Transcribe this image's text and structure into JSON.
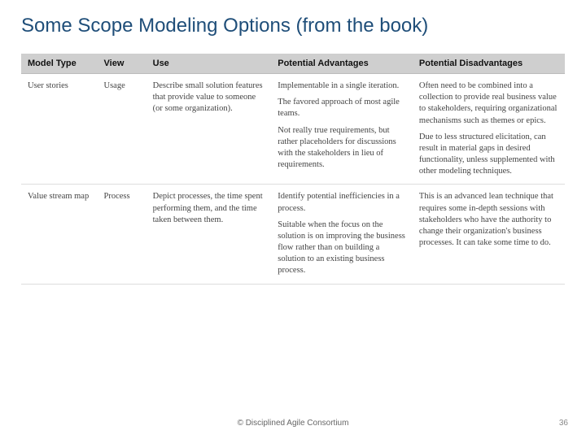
{
  "title": "Some Scope Modeling Options (from the book)",
  "footer": "© Disciplined Agile Consortium",
  "pageNumber": "36",
  "table": {
    "headers": [
      "Model Type",
      "View",
      "Use",
      "Potential Advantages",
      "Potential Disadvantages"
    ],
    "rows": [
      {
        "modelType": "User stories",
        "view": "Usage",
        "use": [
          "Describe small solution features that provide value to someone (or some organization)."
        ],
        "advantages": [
          "Implementable in a single iteration.",
          "The favored approach of most agile teams.",
          "Not really true requirements, but rather placeholders for discussions with the stakeholders in lieu of requirements."
        ],
        "disadvantages": [
          "Often need to be combined into a collection to provide real business value to stakeholders, requiring organizational mechanisms such as themes or epics.",
          "Due to less structured elicitation, can result in material gaps in desired functionality, unless supplemented with other modeling techniques."
        ]
      },
      {
        "modelType": "Value stream map",
        "view": "Process",
        "use": [
          "Depict processes, the time spent performing them, and the time taken between them."
        ],
        "advantages": [
          "Identify potential inefficiencies in a process.",
          "Suitable when the focus on the solution is on improving the business flow rather than on building a solution to an existing business process."
        ],
        "disadvantages": [
          "This is an advanced lean technique that requires some in-depth sessions with stakeholders who have the authority to change their organization's business processes. It can take some time to do."
        ]
      }
    ]
  }
}
